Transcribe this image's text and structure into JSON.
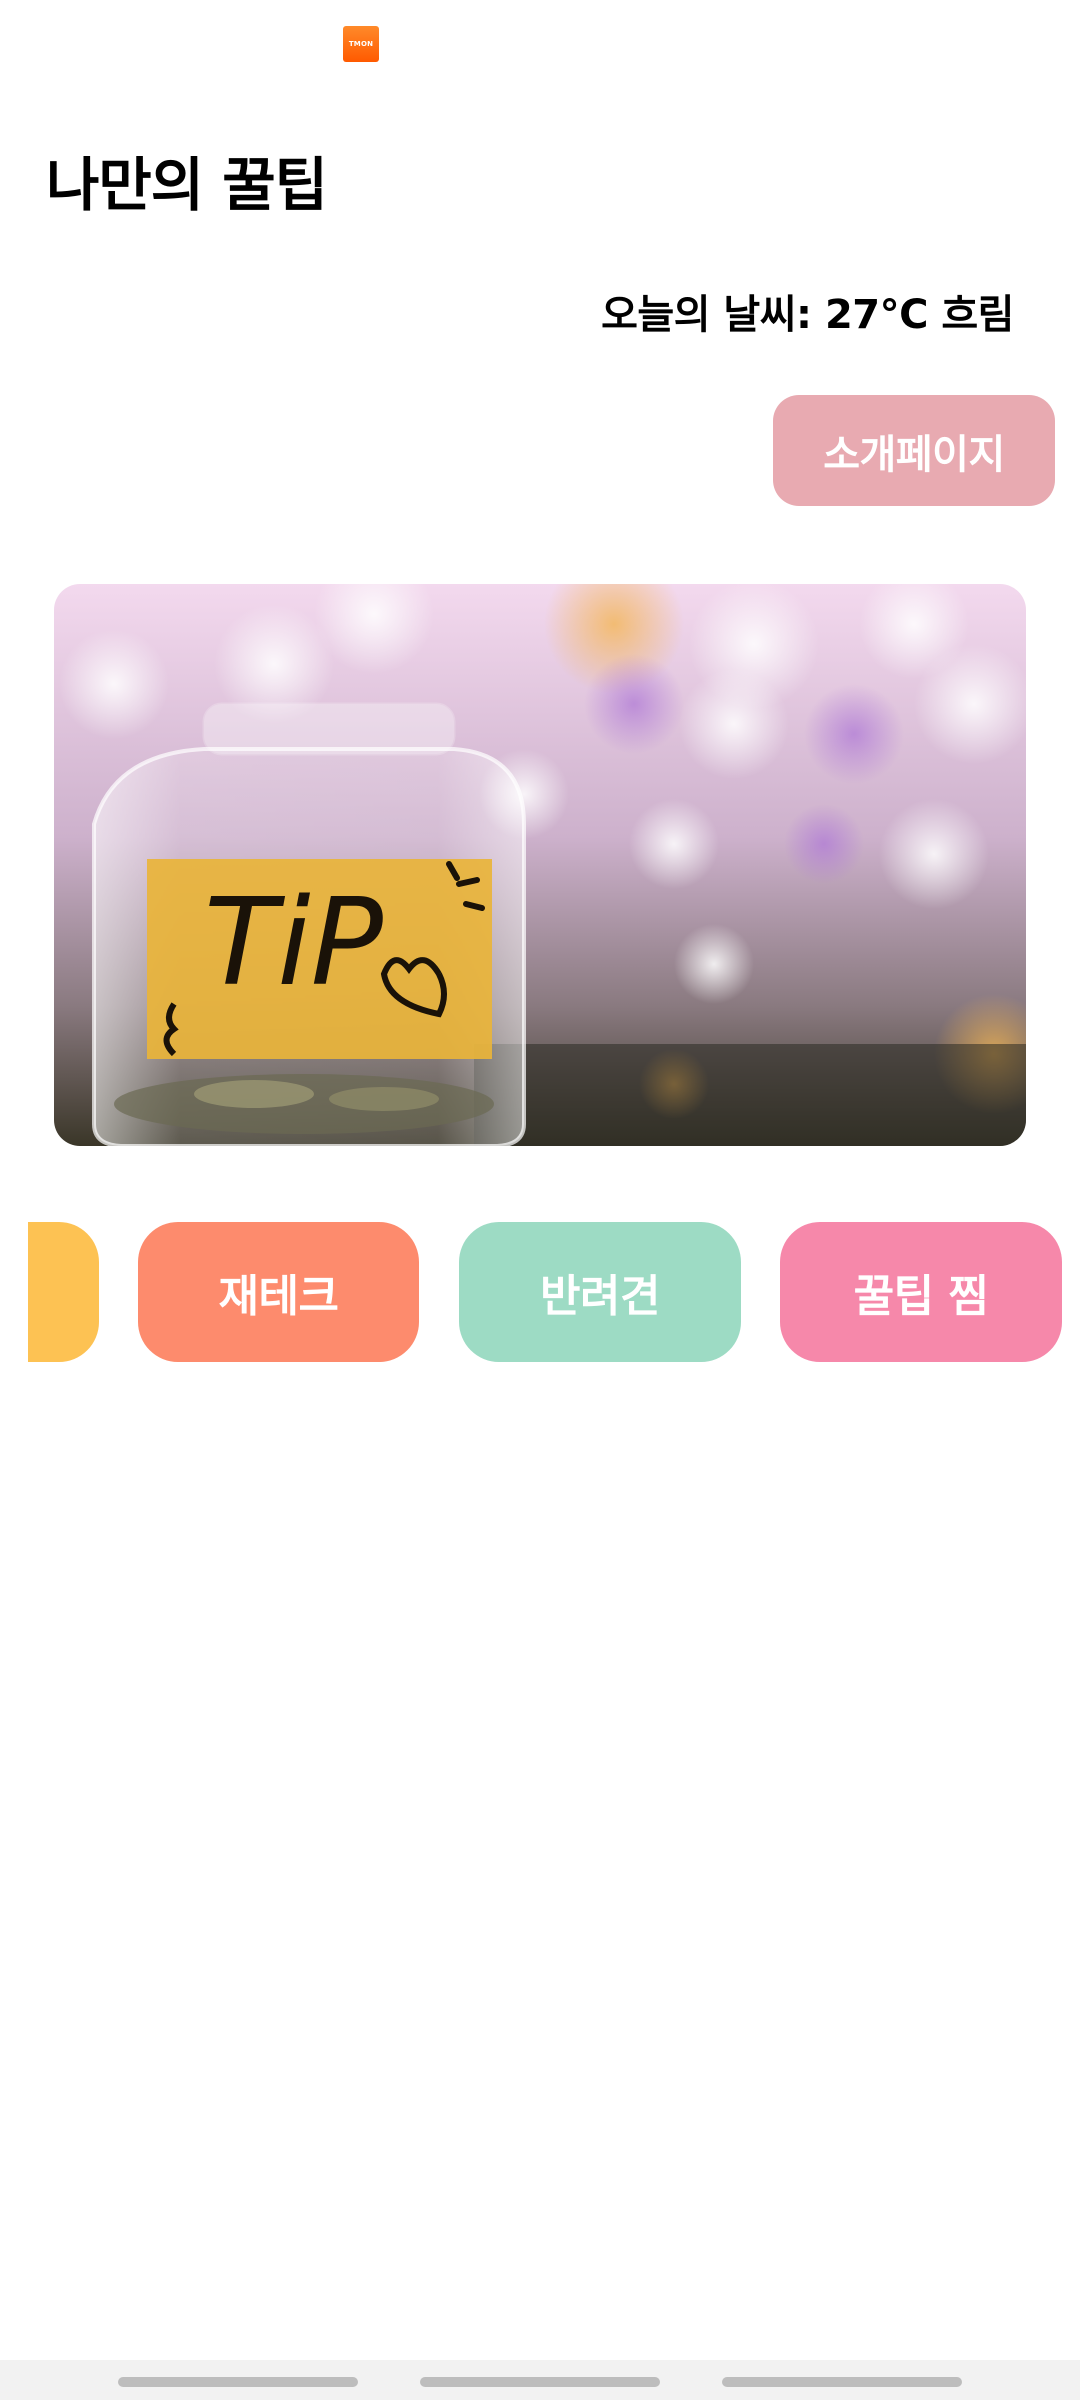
{
  "status_bar": {
    "app_icon_label": "TMON",
    "app_icon_color": "#ff6a10"
  },
  "header": {
    "title": "나만의 꿀팁"
  },
  "weather": {
    "text": "오늘의 날씨: 27°C 흐림"
  },
  "intro_button": {
    "label": "소개페이지",
    "color": "#e8aab1"
  },
  "hero": {
    "image_text": "TiP"
  },
  "categories": [
    {
      "label": "",
      "color": "#fdc253"
    },
    {
      "label": "재테크",
      "color": "#fd8b6d"
    },
    {
      "label": "반려견",
      "color": "#9ddbc4"
    },
    {
      "label": "꿀팁 찜",
      "color": "#f688aa"
    }
  ]
}
